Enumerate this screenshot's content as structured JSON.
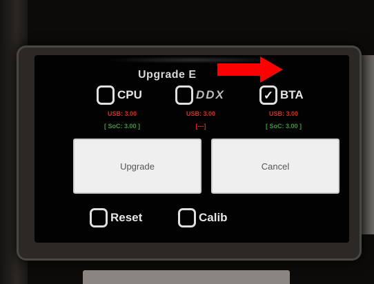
{
  "dialog": {
    "title": "Upgrade E",
    "options": [
      {
        "label": "CPU",
        "checked": false
      },
      {
        "label": "DDX",
        "checked": false
      },
      {
        "label": "BTA",
        "checked": true
      }
    ],
    "versions": [
      {
        "usb": "USB: 3.00",
        "soc": "[ SoC: 3.00 ]",
        "soc_color": "#3f9b38"
      },
      {
        "usb": "USB: 3.00",
        "soc": "[---]",
        "soc_color": "#e02a1c"
      },
      {
        "usb": "USB: 3.00",
        "soc": "[ SoC: 3.00 ]",
        "soc_color": "#3f9b38"
      }
    ],
    "buttons": {
      "upgrade": "Upgrade",
      "cancel": "Cancel"
    },
    "bottom_options": [
      {
        "label": "Reset",
        "checked": false
      },
      {
        "label": "Calib",
        "checked": false
      }
    ]
  },
  "annotation": {
    "arrow_color": "#ff0000",
    "icon": "arrow-right-icon"
  },
  "colors": {
    "accent_red": "#e02a1c",
    "accent_green": "#3f9b38"
  }
}
